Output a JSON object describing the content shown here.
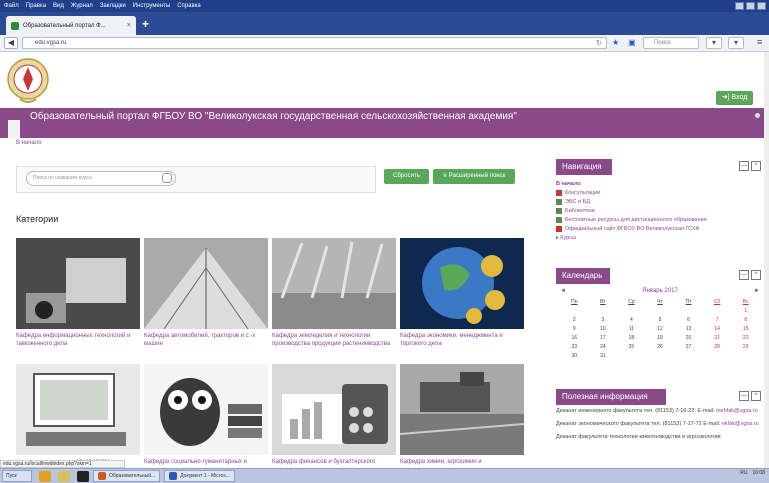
{
  "browser": {
    "menu": [
      "Файл",
      "Правка",
      "Вид",
      "Журнал",
      "Закладки",
      "Инструменты",
      "Справка"
    ],
    "tab_title": "Образовательный портал Ф...",
    "tab_close": "×",
    "new_tab": "+",
    "url": "edu.vgsa.ru",
    "search_placeholder": "Поиск",
    "status_url": "edu.vgsa.ru/local/inwdindex.php?skin=1"
  },
  "header": {
    "login_label": "Вход",
    "site_title": "Образовательный портал ФГБОУ ВО \"Великолукская государственная сельскохозяйственная академия\"",
    "breadcrumb": "В начало"
  },
  "search": {
    "placeholder": "Поиск по названию курса",
    "reset_label": "Сбросить",
    "advanced_label": "Расширенный поиск"
  },
  "categories": {
    "title": "Категории",
    "items": [
      {
        "label": "Кафедра информационных технологий и таможенного дела",
        "color": "#5a5a5a"
      },
      {
        "label": "Кафедра автомобилей, тракторов и с.-х машин",
        "color": "#8a8a8a"
      },
      {
        "label": "Кафедра земледелия и технологии производства продукции растениеводства",
        "color": "#9c9c9c"
      },
      {
        "label": "Кафедра экономики, менеджмента и торгового дела",
        "color": "#1c3a6a"
      },
      {
        "label": "отноводства",
        "color": "#7a7a7a"
      },
      {
        "label": "Кафедра социально-гуманитарных и",
        "color": "#6a6a6a"
      },
      {
        "label": "Кафедра финансов и бухгалтерского",
        "color": "#bdbdbd"
      },
      {
        "label": "Кафедра химии, агрохимии и",
        "color": "#8d8d8d"
      }
    ]
  },
  "navigation": {
    "title": "Навигация",
    "home": "В начало",
    "items": [
      "Консультации",
      "ЭБС и БД",
      "Библиотеки",
      "Бесплатные ресурсы для дистанционного образования",
      "Официальный сайт ФГБОУ ВО Великолукская ГСХА"
    ],
    "courses": "Курсы"
  },
  "calendar": {
    "title": "Календарь",
    "month": "Январь 2017",
    "prev": "◄",
    "next": "►",
    "days": [
      "Пн",
      "Вт",
      "Ср",
      "Чт",
      "Пт",
      "Сб",
      "Вс"
    ],
    "cells": [
      "",
      "",
      "",
      "",
      "",
      "",
      "1",
      "2",
      "3",
      "4",
      "5",
      "6",
      "7",
      "8",
      "9",
      "10",
      "11",
      "12",
      "13",
      "14",
      "15",
      "16",
      "17",
      "18",
      "19",
      "20",
      "21",
      "22",
      "23",
      "24",
      "25",
      "26",
      "27",
      "28",
      "29",
      "30",
      "31",
      "",
      "",
      "",
      "",
      ""
    ]
  },
  "info": {
    "title": "Полезная информация",
    "entries": [
      {
        "text": "Деканат инженерного факультета тел. (81153) 7-16-22; E-mail:",
        "email": "mehfak@vgsa.ru"
      },
      {
        "text": "Деканат экономического факультета тел. (81153) 7-17-72 E-mail:",
        "email": "ekfak@vgsa.ru"
      },
      {
        "text": "Деканат факультета технологии животноводства и агроэкологии",
        "email": ""
      }
    ]
  },
  "taskbar": {
    "start": "Пуск",
    "task1": "Образовательный...",
    "task2": "Документ 1 - Micros...",
    "lang": "RU",
    "time": "16:08"
  },
  "colors": {
    "accent": "#8a4a8a",
    "button": "#5aa75a"
  }
}
